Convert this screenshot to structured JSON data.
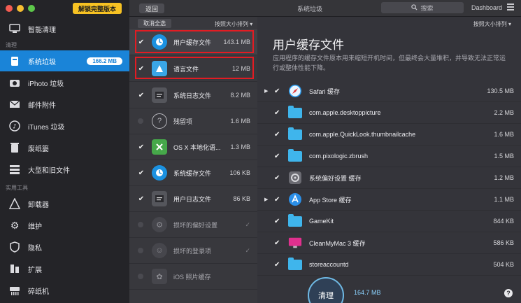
{
  "sidebar": {
    "unlock_button": "解锁完整版本",
    "section_cleanup": "清理",
    "section_tools": "实用工具",
    "items": [
      {
        "label": "智能清理",
        "icon": "monitor-icon"
      },
      {
        "label": "系统垃圾",
        "icon": "trash-system-icon",
        "badge": "166.2 MB",
        "active": true
      },
      {
        "label": "iPhoto 垃圾",
        "icon": "camera-icon"
      },
      {
        "label": "邮件附件",
        "icon": "mail-icon"
      },
      {
        "label": "iTunes 垃圾",
        "icon": "music-icon"
      },
      {
        "label": "废纸篓",
        "icon": "trash-bin-icon"
      },
      {
        "label": "大型和旧文件",
        "icon": "stack-icon"
      },
      {
        "label": "卸载器",
        "icon": "uninstaller-icon"
      },
      {
        "label": "维护",
        "icon": "gear-icon"
      },
      {
        "label": "隐私",
        "icon": "shield-icon"
      },
      {
        "label": "扩展",
        "icon": "extension-icon"
      },
      {
        "label": "碎纸机",
        "icon": "shredder-icon"
      }
    ]
  },
  "topbar": {
    "back_label": "返回",
    "title": "系统垃圾",
    "search_placeholder": "搜索",
    "dashboard_label": "Dashboard"
  },
  "middle": {
    "deselect_all": "取消全选",
    "sort_label": "按照大小排列",
    "rows": [
      {
        "name": "用户缓存文件",
        "size": "143.1 MB",
        "checked": true,
        "icon": "user-cache-icon"
      },
      {
        "name": "语言文件",
        "size": "12 MB",
        "checked": true,
        "icon": "language-icon"
      },
      {
        "name": "系统日志文件",
        "size": "8.2 MB",
        "checked": true,
        "icon": "system-log-icon"
      },
      {
        "name": "残留项",
        "size": "1.6 MB",
        "checked": false,
        "icon": "question-icon"
      },
      {
        "name": "OS X 本地化语...",
        "size": "1.3 MB",
        "checked": true,
        "icon": "osx-localization-icon"
      },
      {
        "name": "系统缓存文件",
        "size": "106 KB",
        "checked": true,
        "icon": "system-cache-icon"
      },
      {
        "name": "用户日志文件",
        "size": "86 KB",
        "checked": true,
        "icon": "user-log-icon"
      },
      {
        "name": "损坏的偏好设置",
        "size": "",
        "checked": false,
        "icon": "broken-prefs-icon"
      },
      {
        "name": "损坏的登录项",
        "size": "",
        "checked": false,
        "icon": "broken-login-icon"
      },
      {
        "name": "iOS 照片缓存",
        "size": "",
        "checked": false,
        "icon": "ios-photo-icon"
      }
    ]
  },
  "detail": {
    "sort_label": "按照大小排列",
    "title": "用户缓存文件",
    "description": "应用程序的缓存文件原本用来缩短开机时间，但最终会大量堆积，并导致无法正常运行或整体性能下降。",
    "rows": [
      {
        "name": "Safari 缓存",
        "size": "130.5 MB",
        "expandable": true,
        "icon": "safari-icon"
      },
      {
        "name": "com.apple.desktoppicture",
        "size": "2.2 MB",
        "expandable": false,
        "icon": "folder-icon"
      },
      {
        "name": "com.apple.QuickLook.thumbnailcache",
        "size": "1.6 MB",
        "expandable": false,
        "icon": "folder-icon"
      },
      {
        "name": "com.pixologic.zbrush",
        "size": "1.5 MB",
        "expandable": false,
        "icon": "folder-icon"
      },
      {
        "name": "系统偏好设置 缓存",
        "size": "1.2 MB",
        "expandable": false,
        "icon": "system-prefs-icon"
      },
      {
        "name": "App Store 缓存",
        "size": "1.1 MB",
        "expandable": true,
        "icon": "app-store-icon"
      },
      {
        "name": "GameKit",
        "size": "844 KB",
        "expandable": false,
        "icon": "folder-icon"
      },
      {
        "name": "CleanMyMac 3 缓存",
        "size": "586 KB",
        "expandable": false,
        "icon": "cleanmymac-icon"
      },
      {
        "name": "storeaccountd",
        "size": "504 KB",
        "expandable": false,
        "icon": "folder-icon"
      }
    ]
  },
  "footer": {
    "clean_label": "清理",
    "total_size": "164.7 MB",
    "help_label": "?"
  },
  "colors": {
    "accent": "#1a84d8",
    "highlight_box": "#e21c23",
    "unlock": "#f7c223"
  }
}
